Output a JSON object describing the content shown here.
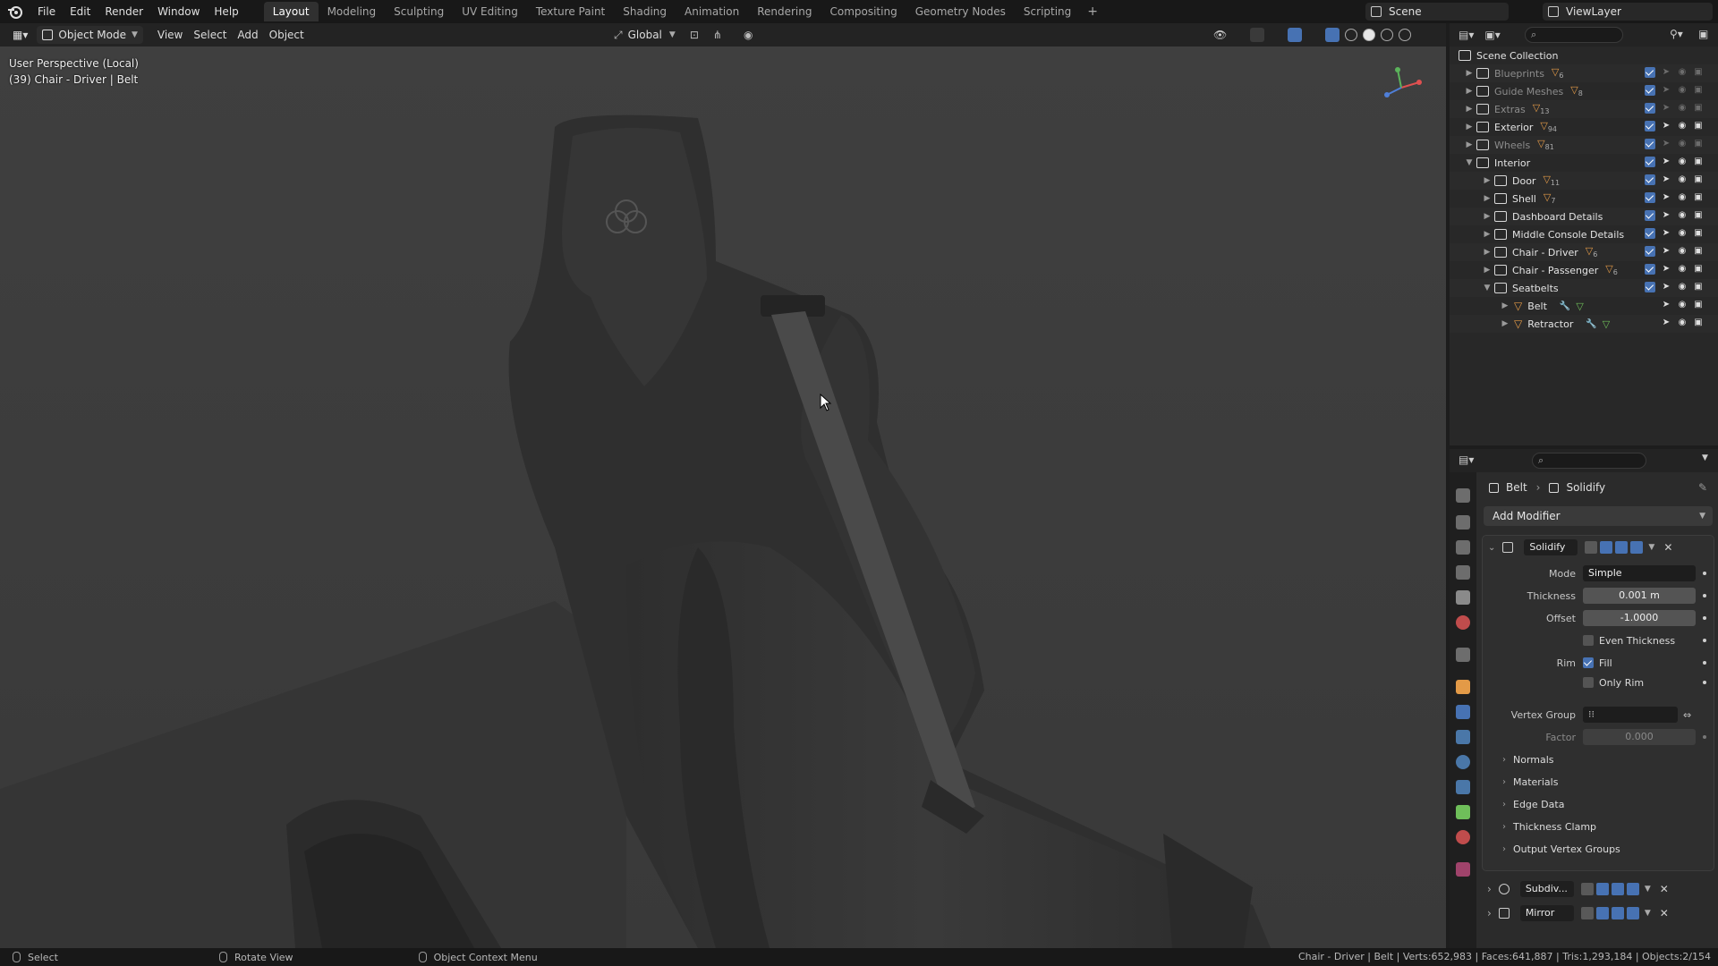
{
  "menu": [
    "File",
    "Edit",
    "Render",
    "Window",
    "Help"
  ],
  "workspaces": [
    "Layout",
    "Modeling",
    "Sculpting",
    "UV Editing",
    "Texture Paint",
    "Shading",
    "Animation",
    "Rendering",
    "Compositing",
    "Geometry Nodes",
    "Scripting"
  ],
  "active_workspace": "Layout",
  "scene": "Scene",
  "view_layer": "ViewLayer",
  "viewport_header": {
    "mode": "Object Mode",
    "view": "View",
    "select": "Select",
    "add": "Add",
    "object": "Object",
    "orientation": "Global"
  },
  "viewport": {
    "perspective": "User Perspective (Local)",
    "active": "(39) Chair - Driver | Belt"
  },
  "outliner": {
    "root": "Scene Collection",
    "items": [
      {
        "name": "Blueprints",
        "count": "6",
        "dim": true
      },
      {
        "name": "Guide Meshes",
        "count": "8",
        "dim": true
      },
      {
        "name": "Extras",
        "count": "13",
        "dim": true
      },
      {
        "name": "Exterior",
        "count": "94",
        "dim": false
      },
      {
        "name": "Wheels",
        "count": "81",
        "dim": true
      },
      {
        "name": "Interior",
        "count": "",
        "dim": false
      },
      {
        "name": "Door",
        "count": "11",
        "dim": false
      },
      {
        "name": "Shell",
        "count": "7",
        "dim": false
      },
      {
        "name": "Dashboard Details",
        "count": "",
        "dim": false
      },
      {
        "name": "Middle Console Details",
        "count": "",
        "dim": false
      },
      {
        "name": "Chair - Driver",
        "count": "6",
        "dim": false
      },
      {
        "name": "Chair - Passenger",
        "count": "6",
        "dim": false
      },
      {
        "name": "Seatbelts",
        "count": "",
        "dim": false
      },
      {
        "name": "Belt",
        "count": "",
        "dim": false
      },
      {
        "name": "Retractor",
        "count": "",
        "dim": false
      }
    ]
  },
  "properties": {
    "breadcrumb_object": "Belt",
    "breadcrumb_modifier": "Solidify",
    "add_modifier": "Add Modifier",
    "solidify": {
      "name": "Solidify",
      "mode_label": "Mode",
      "mode": "Simple",
      "thickness_label": "Thickness",
      "thickness": "0.001 m",
      "offset_label": "Offset",
      "offset": "-1.0000",
      "even_thickness": "Even Thickness",
      "rim_label": "Rim",
      "fill": "Fill",
      "only_rim": "Only Rim",
      "vertex_group_label": "Vertex Group",
      "factor_label": "Factor",
      "factor": "0.000",
      "subpanels": [
        "Normals",
        "Materials",
        "Edge Data",
        "Thickness Clamp",
        "Output Vertex Groups"
      ]
    },
    "other_modifiers": [
      "Subdiv...",
      "Mirror"
    ]
  },
  "status": {
    "left": "Select",
    "middle": "Rotate View",
    "right": "Object Context Menu",
    "stats": "Chair - Driver | Belt | Verts:652,983 | Faces:641,887 | Tris:1,293,184 | Objects:2/154"
  },
  "colors": {
    "accent": "#4772b3",
    "object_orange": "#e39a47",
    "mesh_green": "#6fbf5a"
  }
}
